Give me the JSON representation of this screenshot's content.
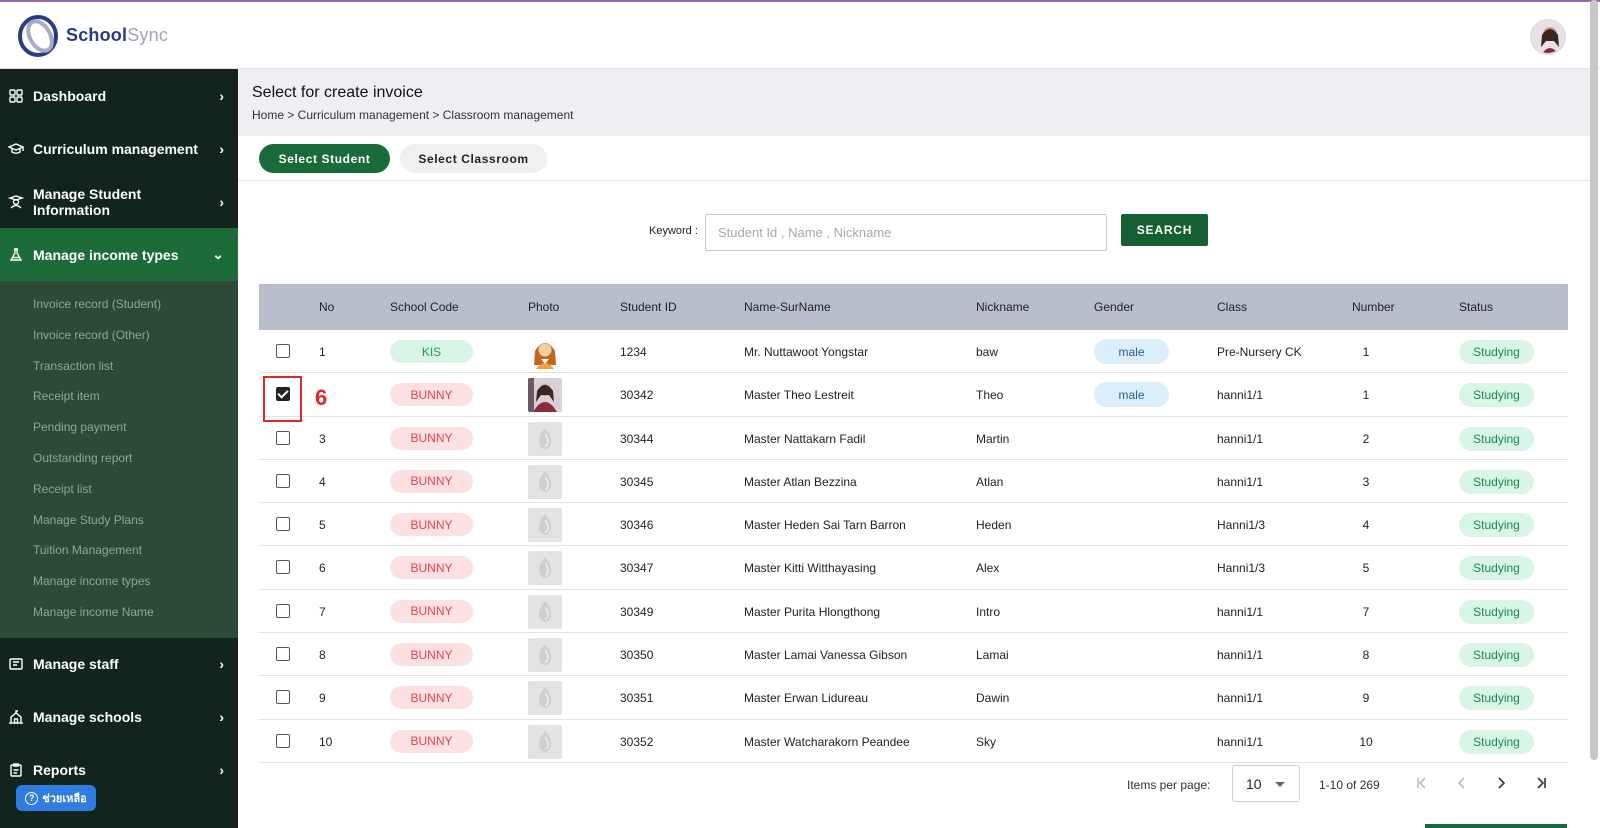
{
  "app": {
    "logo_primary": "School",
    "logo_secondary": "Sync"
  },
  "sidebar": {
    "items": [
      {
        "label": "Dashboard",
        "icon": "grid-icon"
      },
      {
        "label": "Curriculum management",
        "icon": "graduation-cap-icon"
      },
      {
        "label": "Manage Student Information",
        "icon": "student-icon"
      },
      {
        "label": "Manage income types",
        "icon": "flask-icon"
      },
      {
        "label": "Manage staff",
        "icon": "id-card-icon"
      },
      {
        "label": "Manage schools",
        "icon": "school-icon"
      },
      {
        "label": "Reports",
        "icon": "clipboard-icon"
      }
    ],
    "submenu": [
      "Invoice record (Student)",
      "Invoice record (Other)",
      "Transaction list",
      "Receipt item",
      "Pending payment",
      "Outstanding report",
      "Receipt list",
      "Manage Study Plans",
      "Tuition Management",
      "Manage income types",
      "Manage income Name"
    ],
    "help_label": "ช่วยเหลือ"
  },
  "header": {
    "title": "Select for create invoice",
    "breadcrumb": "Home > Curriculum management > Classroom management"
  },
  "tabs": [
    "Select Student",
    "Select Classroom"
  ],
  "search": {
    "label": "Keyword :",
    "placeholder": "Student Id , Name , Nickname",
    "value": "",
    "button": "SEARCH"
  },
  "table": {
    "columns": [
      "No",
      "School Code",
      "Photo",
      "Student ID",
      "Name-SurName",
      "Nickname",
      "Gender",
      "Class",
      "Number",
      "Status"
    ],
    "rows": [
      {
        "no": "1",
        "code": "KIS",
        "photo": "cartoon",
        "sid": "1234",
        "name": "Mr. Nuttawoot Yongstar",
        "nick": "baw",
        "gender": "male",
        "cls": "Pre-Nursery CK",
        "num": "1",
        "status": "Studying",
        "checked": false
      },
      {
        "no": "",
        "code": "BUNNY",
        "photo": "portrait",
        "sid": "30342",
        "name": "Master Theo Lestreit",
        "nick": "Theo",
        "gender": "male",
        "cls": "hanni1/1",
        "num": "1",
        "status": "Studying",
        "checked": true
      },
      {
        "no": "3",
        "code": "BUNNY",
        "photo": "placeholder",
        "sid": "30344",
        "name": "Master Nattakarn Fadil",
        "nick": "Martin",
        "gender": "",
        "cls": "hanni1/1",
        "num": "2",
        "status": "Studying",
        "checked": false
      },
      {
        "no": "4",
        "code": "BUNNY",
        "photo": "placeholder",
        "sid": "30345",
        "name": "Master Atlan Bezzina",
        "nick": "Atlan",
        "gender": "",
        "cls": "hanni1/1",
        "num": "3",
        "status": "Studying",
        "checked": false
      },
      {
        "no": "5",
        "code": "BUNNY",
        "photo": "placeholder",
        "sid": "30346",
        "name": "Master Heden Sai Tarn Barron",
        "nick": "Heden",
        "gender": "",
        "cls": "Hanni1/3",
        "num": "4",
        "status": "Studying",
        "checked": false
      },
      {
        "no": "6",
        "code": "BUNNY",
        "photo": "placeholder",
        "sid": "30347",
        "name": "Master Kitti Witthayasing",
        "nick": "Alex",
        "gender": "",
        "cls": "Hanni1/3",
        "num": "5",
        "status": "Studying",
        "checked": false
      },
      {
        "no": "7",
        "code": "BUNNY",
        "photo": "placeholder",
        "sid": "30349",
        "name": "Master Purita Hlongthong",
        "nick": "Intro",
        "gender": "",
        "cls": "hanni1/1",
        "num": "7",
        "status": "Studying",
        "checked": false
      },
      {
        "no": "8",
        "code": "BUNNY",
        "photo": "placeholder",
        "sid": "30350",
        "name": "Master Lamai Vanessa Gibson",
        "nick": "Lamai",
        "gender": "",
        "cls": "hanni1/1",
        "num": "8",
        "status": "Studying",
        "checked": false
      },
      {
        "no": "9",
        "code": "BUNNY",
        "photo": "placeholder",
        "sid": "30351",
        "name": "Master Erwan Lidureau",
        "nick": "Dawin",
        "gender": "",
        "cls": "hanni1/1",
        "num": "9",
        "status": "Studying",
        "checked": false
      },
      {
        "no": "10",
        "code": "BUNNY",
        "photo": "placeholder",
        "sid": "30352",
        "name": "Master Watcharakorn Peandee",
        "nick": "Sky",
        "gender": "",
        "cls": "hanni1/1",
        "num": "10",
        "status": "Studying",
        "checked": false
      }
    ]
  },
  "annotation": "6",
  "pager": {
    "label": "Items per page:",
    "size": "10",
    "range": "1-10 of 269"
  },
  "colors": {
    "sidebar_bg": "#13241f",
    "active_green": "#1d6b39",
    "accent_green": "#165f32",
    "annotation_red": "#e12727"
  }
}
